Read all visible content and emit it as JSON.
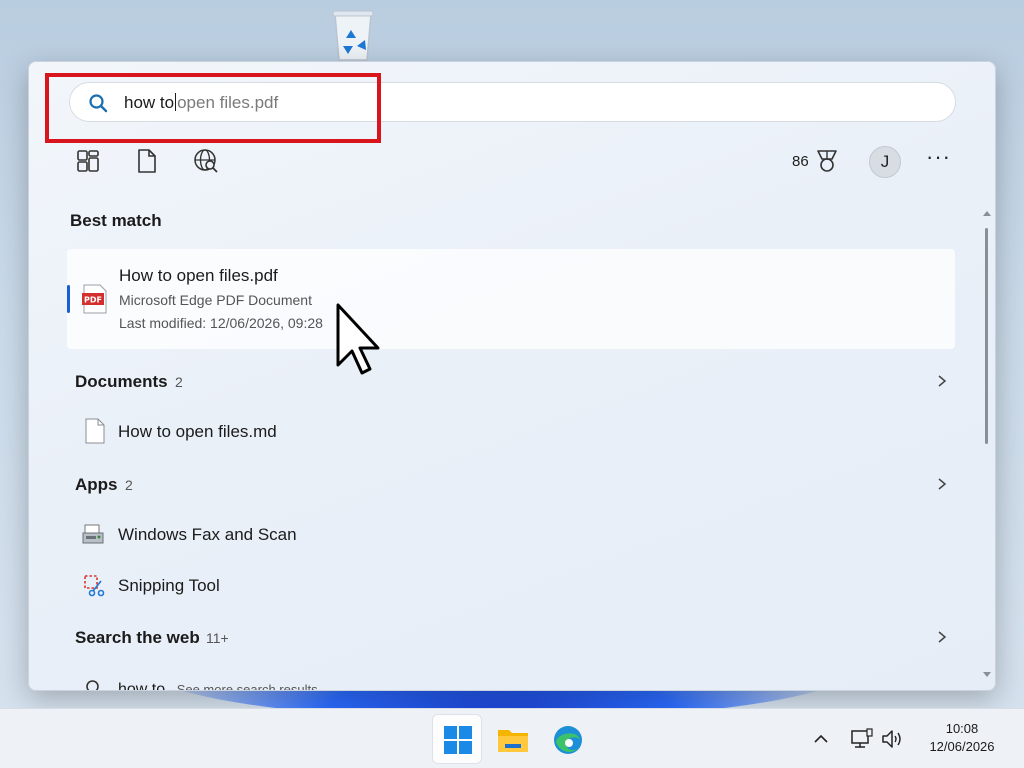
{
  "search": {
    "typed": "how to",
    "suggestion": "open files.pdf"
  },
  "header": {
    "points": "86",
    "avatar_initial": "J",
    "more_label": "···"
  },
  "best_match": {
    "section_title": "Best match",
    "title": "How to open files.pdf",
    "subtitle": "Microsoft Edge PDF Document",
    "modified": "Last modified: 12/06/2026, 09:28",
    "pdf_badge": "PDF"
  },
  "documents": {
    "title": "Documents",
    "count": "2",
    "items": [
      {
        "label": "How to open files.md"
      }
    ]
  },
  "apps": {
    "title": "Apps",
    "count": "2",
    "items": [
      {
        "label": "Windows Fax and Scan"
      },
      {
        "label": "Snipping Tool"
      }
    ]
  },
  "web": {
    "title": "Search the web",
    "count": "11+",
    "query": "how to",
    "hint": " - See more search results"
  },
  "taskbar": {
    "time": "10:08",
    "date": "12/06/2026"
  },
  "colors": {
    "accent": "#1a5fd0",
    "highlight_box": "#d8141c"
  },
  "icons": [
    "recycle-bin-icon",
    "search-icon",
    "filter-apps-icon",
    "filter-documents-icon",
    "filter-web-icon",
    "trophy-icon",
    "pdf-icon",
    "document-icon",
    "fax-scan-icon",
    "snipping-tool-icon",
    "chevron-right-icon",
    "start-icon",
    "file-explorer-icon",
    "edge-icon",
    "network-icon",
    "volume-icon",
    "mouse-cursor-icon"
  ]
}
